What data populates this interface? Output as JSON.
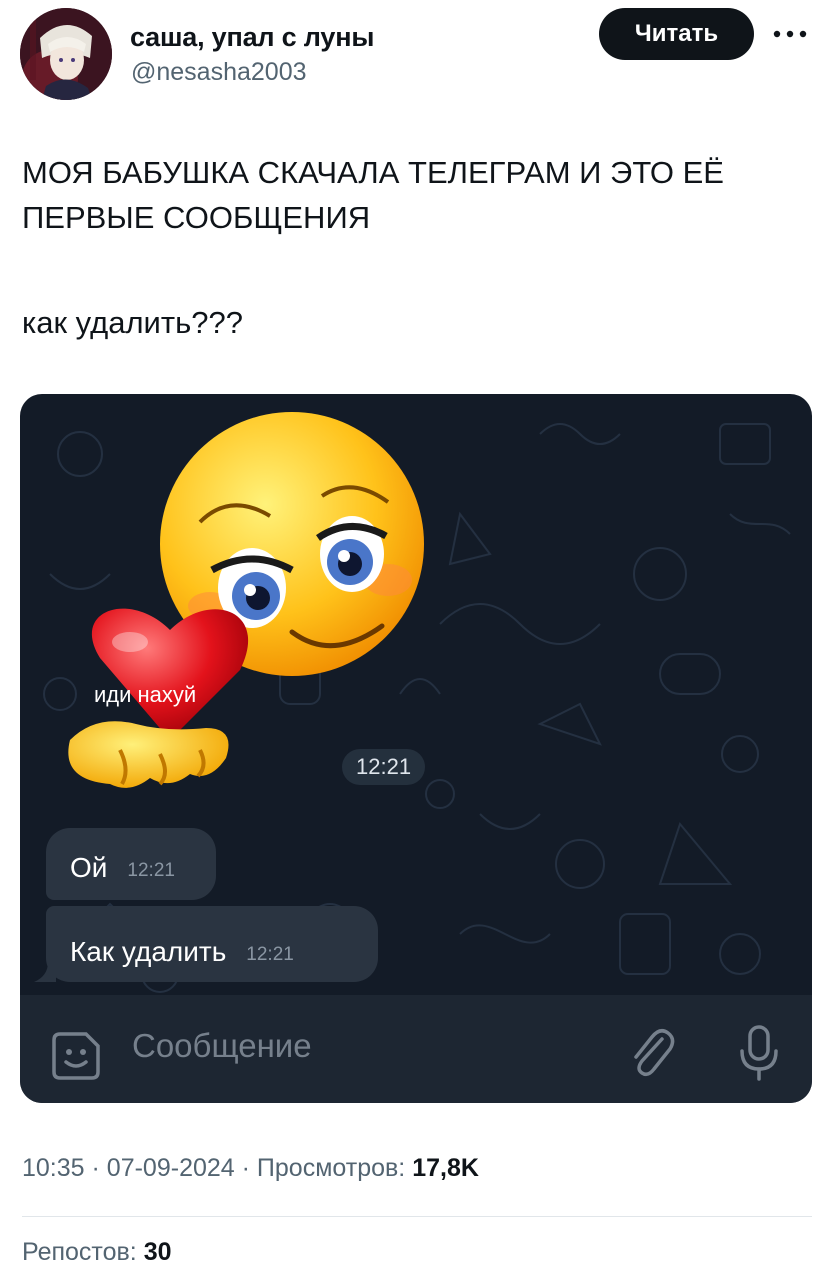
{
  "author": {
    "display_name": "саша, упал с луны",
    "handle": "@nesasha2003"
  },
  "actions": {
    "follow_label": "Читать",
    "more_icon": "more-horizontal-icon"
  },
  "tweet": {
    "text_line1": "МОЯ БАБУШКА СКАЧАЛА ТЕЛЕГРАМ И ЭТО ЕЁ ПЕРВЫЕ СООБЩЕНИЯ",
    "text_line2": "как удалить???"
  },
  "telegram": {
    "sticker_caption": "иди нахуй",
    "sticker_time": "12:21",
    "messages": [
      {
        "text": "Ой",
        "time": "12:21"
      },
      {
        "text": "Как удалить",
        "time": "12:21"
      }
    ],
    "input_placeholder": "Сообщение",
    "icons": [
      "sticker-icon",
      "paperclip-icon",
      "microphone-icon"
    ]
  },
  "meta": {
    "time": "10:35",
    "date": "07-09-2024",
    "views_label": "Просмотров:",
    "views_value": "17,8K",
    "reposts_label": "Репостов:",
    "reposts_value": "30"
  },
  "colors": {
    "chat_bg": "#131b27",
    "bubble": "#2a3441",
    "input_bar": "#1d2632",
    "follow_button": "#0f1419"
  }
}
